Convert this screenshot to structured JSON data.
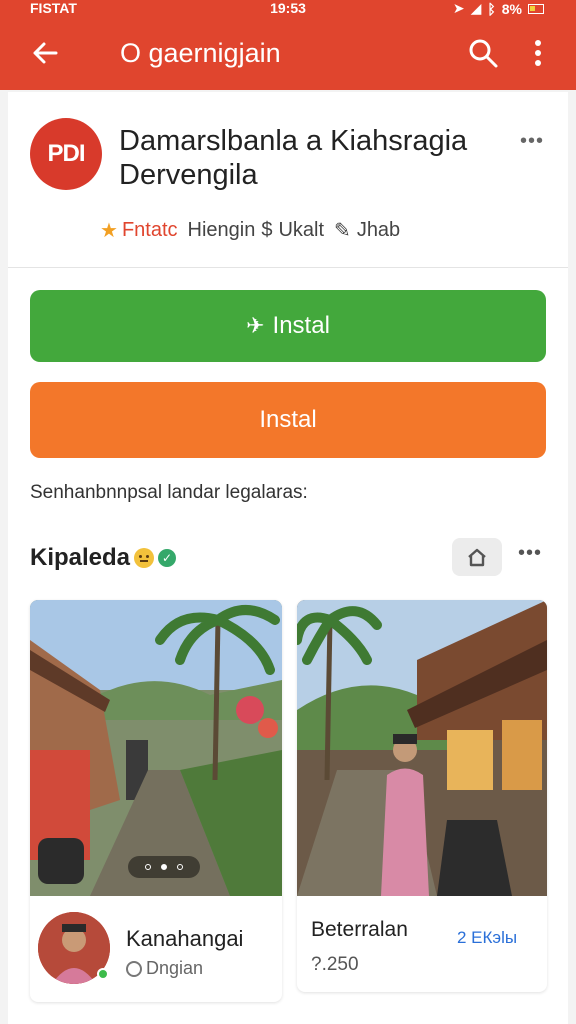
{
  "status_bar": {
    "carrier": "FISTAT",
    "time": "19:53",
    "battery": "8%"
  },
  "app_bar": {
    "title": "O gaernigjain"
  },
  "app": {
    "icon_text": "PDI",
    "name": "Damarslbanla a Kiahsragia Dervengila",
    "rating_label": "Fntatc",
    "meta_1": "Hiengin",
    "meta_2": "Ukalt",
    "meta_3": "Jhab"
  },
  "buttons": {
    "primary": "Instal",
    "secondary": "Instal"
  },
  "subtitle": "Senhanbnnpsal landar legalaras:",
  "section": {
    "title": "Kipaleda"
  },
  "tiles": [
    {
      "name": "Kanahangai",
      "sub": "Dngian"
    },
    {
      "name": "Beterralan",
      "price": "?.250",
      "tag": "2 ЕКэlы"
    }
  ],
  "colors": {
    "header": "#e0452e",
    "primary_button": "#43a83c",
    "secondary_button": "#f3772a"
  }
}
